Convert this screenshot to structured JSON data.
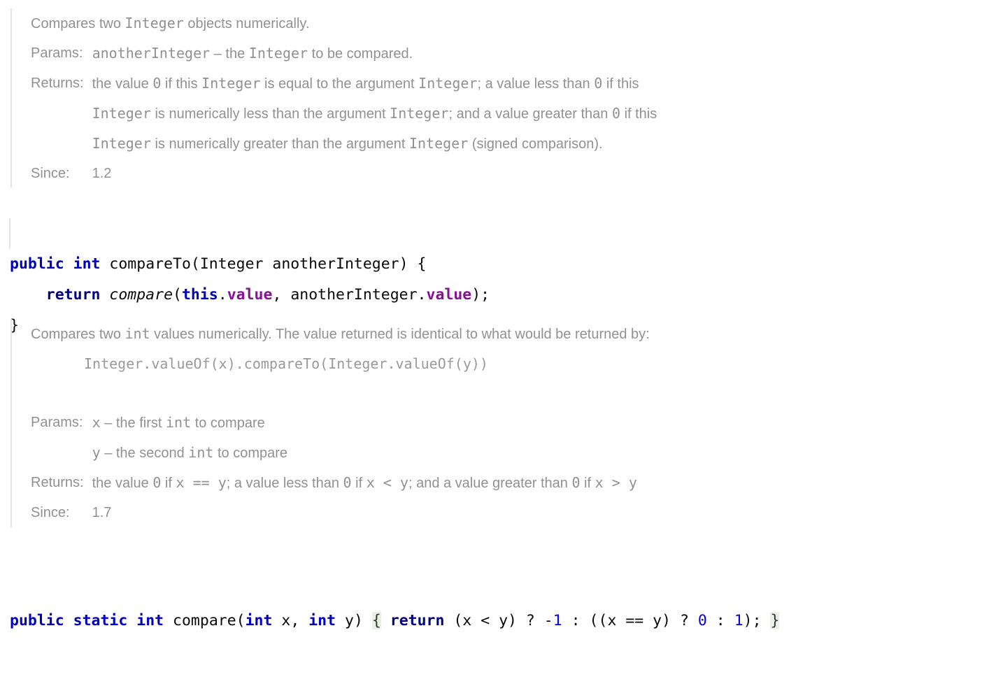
{
  "editor": {
    "language": "java",
    "colors": {
      "keyword": "#0000c0",
      "keyword_dark": "#000080",
      "field": "#871094",
      "number": "#0000ff",
      "doc_text": "#919191",
      "doc_rail": "#e4e4e4",
      "brace_match_highlight": "#e8f2e4",
      "background": "#ffffff",
      "code_text": "#080808"
    }
  },
  "doc1": {
    "summary": "Compares two Integer objects numerically.",
    "summary_parts": [
      {
        "text": "Compares two ",
        "mono": false
      },
      {
        "text": "Integer",
        "mono": true
      },
      {
        "text": " objects numerically.",
        "mono": false
      }
    ],
    "tags": [
      {
        "label": "Params:",
        "lines": [
          [
            {
              "text": "anotherInteger",
              "mono": true
            },
            {
              "text": " – the ",
              "mono": false
            },
            {
              "text": "Integer",
              "mono": true
            },
            {
              "text": " to be compared.",
              "mono": false
            }
          ]
        ]
      },
      {
        "label": "Returns:",
        "lines": [
          [
            {
              "text": "the value ",
              "mono": false
            },
            {
              "text": "0",
              "mono": true
            },
            {
              "text": " if this ",
              "mono": false
            },
            {
              "text": "Integer",
              "mono": true
            },
            {
              "text": " is equal to the argument ",
              "mono": false
            },
            {
              "text": "Integer",
              "mono": true
            },
            {
              "text": "; a value less than ",
              "mono": false
            },
            {
              "text": "0",
              "mono": true
            },
            {
              "text": " if this",
              "mono": false
            }
          ],
          [
            {
              "text": "Integer",
              "mono": true
            },
            {
              "text": " is numerically less than the argument ",
              "mono": false
            },
            {
              "text": "Integer",
              "mono": true
            },
            {
              "text": "; and a value greater than ",
              "mono": false
            },
            {
              "text": "0",
              "mono": true
            },
            {
              "text": " if this",
              "mono": false
            }
          ],
          [
            {
              "text": "Integer",
              "mono": true
            },
            {
              "text": " is numerically greater than the argument ",
              "mono": false
            },
            {
              "text": "Integer",
              "mono": true
            },
            {
              "text": " (signed comparison).",
              "mono": false
            }
          ]
        ]
      },
      {
        "label": "Since:",
        "lines": [
          [
            {
              "text": "1.2",
              "mono": false
            }
          ]
        ]
      }
    ]
  },
  "code1": {
    "lines": [
      [
        {
          "text": "public",
          "cls": "kw"
        },
        {
          "text": " ",
          "cls": "plain"
        },
        {
          "text": "int",
          "cls": "kw"
        },
        {
          "text": " compareTo(Integer anotherInteger) {",
          "cls": "plain"
        }
      ],
      [
        {
          "text": "    ",
          "cls": "plain"
        },
        {
          "text": "return",
          "cls": "kw2"
        },
        {
          "text": " ",
          "cls": "plain"
        },
        {
          "text": "compare",
          "cls": "static-m"
        },
        {
          "text": "(",
          "cls": "plain"
        },
        {
          "text": "this",
          "cls": "kw"
        },
        {
          "text": ".",
          "cls": "plain"
        },
        {
          "text": "value",
          "cls": "field"
        },
        {
          "text": ", anotherInteger.",
          "cls": "plain"
        },
        {
          "text": "value",
          "cls": "field"
        },
        {
          "text": ");",
          "cls": "plain"
        }
      ],
      [
        {
          "text": "}",
          "cls": "plain"
        }
      ]
    ]
  },
  "doc2": {
    "summary_parts": [
      {
        "text": "Compares two ",
        "mono": false
      },
      {
        "text": "int",
        "mono": true
      },
      {
        "text": " values numerically. The value returned is identical to what would be returned by:",
        "mono": false
      }
    ],
    "code_sample": "Integer.valueOf(x).compareTo(Integer.valueOf(y))",
    "tags": [
      {
        "label": "Params:",
        "lines": [
          [
            {
              "text": "x",
              "mono": true
            },
            {
              "text": " – the first ",
              "mono": false
            },
            {
              "text": "int",
              "mono": true
            },
            {
              "text": " to compare",
              "mono": false
            }
          ],
          [
            {
              "text": "y",
              "mono": true
            },
            {
              "text": " – the second ",
              "mono": false
            },
            {
              "text": "int",
              "mono": true
            },
            {
              "text": " to compare",
              "mono": false
            }
          ]
        ]
      },
      {
        "label": "Returns:",
        "lines": [
          [
            {
              "text": "the value ",
              "mono": false
            },
            {
              "text": "0",
              "mono": true
            },
            {
              "text": " if ",
              "mono": false
            },
            {
              "text": "x ",
              "mono": true
            },
            {
              "text": "== ",
              "mono": true
            },
            {
              "text": "y",
              "mono": true
            },
            {
              "text": "; a value less than ",
              "mono": false
            },
            {
              "text": "0",
              "mono": true
            },
            {
              "text": " if ",
              "mono": false
            },
            {
              "text": "x ",
              "mono": true
            },
            {
              "text": "< ",
              "mono": true
            },
            {
              "text": "y",
              "mono": true
            },
            {
              "text": "; and a value greater than ",
              "mono": false
            },
            {
              "text": "0",
              "mono": true
            },
            {
              "text": " if ",
              "mono": false
            },
            {
              "text": "x ",
              "mono": true
            },
            {
              "text": "> ",
              "mono": true
            },
            {
              "text": "y",
              "mono": true
            }
          ]
        ]
      },
      {
        "label": "Since:",
        "lines": [
          [
            {
              "text": "1.7",
              "mono": false
            }
          ]
        ]
      }
    ]
  },
  "code2": {
    "lines": [
      [
        {
          "text": "public",
          "cls": "kw"
        },
        {
          "text": " ",
          "cls": "plain"
        },
        {
          "text": "static",
          "cls": "kw"
        },
        {
          "text": " ",
          "cls": "plain"
        },
        {
          "text": "int",
          "cls": "kw"
        },
        {
          "text": " compare(",
          "cls": "plain"
        },
        {
          "text": "int",
          "cls": "kw"
        },
        {
          "text": " x, ",
          "cls": "plain"
        },
        {
          "text": "int",
          "cls": "kw"
        },
        {
          "text": " y) ",
          "cls": "plain"
        },
        {
          "text": "{",
          "cls": "brace-hl"
        },
        {
          "text": " ",
          "cls": "plain"
        },
        {
          "text": "return",
          "cls": "kw2"
        },
        {
          "text": " (x < y) ? -",
          "cls": "plain"
        },
        {
          "text": "1",
          "cls": "num"
        },
        {
          "text": " : ((x == y) ? ",
          "cls": "plain"
        },
        {
          "text": "0",
          "cls": "num"
        },
        {
          "text": " : ",
          "cls": "plain"
        },
        {
          "text": "1",
          "cls": "num"
        },
        {
          "text": "); ",
          "cls": "plain"
        },
        {
          "text": "}",
          "cls": "brace-hl"
        }
      ]
    ]
  }
}
